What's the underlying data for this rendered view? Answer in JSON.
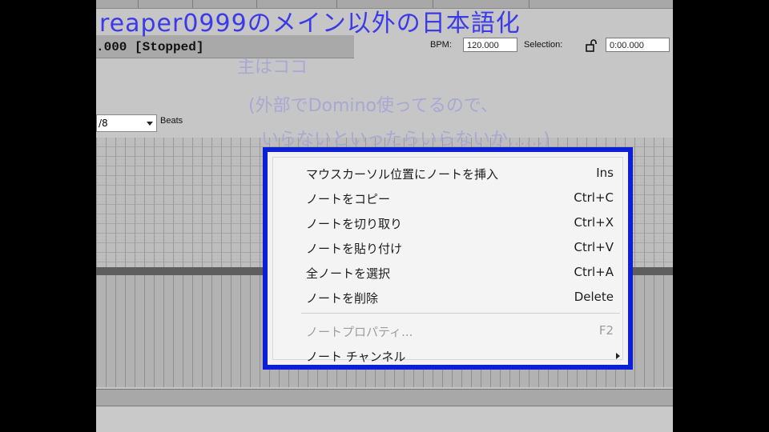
{
  "overlay": {
    "title": "reaper0999のメイン以外の日本語化",
    "note_line1": "主はココ",
    "note_line2": "(外部でDomino使ってるので、",
    "note_line3": "いらないといったらいらないか……)"
  },
  "transport": {
    "time_status": ".000 [Stopped]",
    "bpm_label": "BPM:",
    "bpm_value": "120.000",
    "selection_label": "Selection:",
    "selection_value": "0:00.000"
  },
  "editor": {
    "beats_value": "/8",
    "beats_label": "Beats"
  },
  "context_menu": {
    "items": [
      {
        "label": "マウスカーソル位置にノートを挿入",
        "shortcut": "Ins"
      },
      {
        "label": "ノートをコピー",
        "shortcut": "Ctrl+C"
      },
      {
        "label": "ノートを切り取り",
        "shortcut": "Ctrl+X"
      },
      {
        "label": "ノートを貼り付け",
        "shortcut": "Ctrl+V"
      },
      {
        "label": "全ノートを選択",
        "shortcut": "Ctrl+A"
      },
      {
        "label": "ノートを削除",
        "shortcut": "Delete"
      },
      {
        "label": "ノートプロパティ...",
        "shortcut": "F2"
      },
      {
        "label": "ノート チャンネル",
        "shortcut": ""
      }
    ]
  },
  "colors": {
    "menu_border": "#0a1fd6",
    "overlay_title": "#3a3ae8"
  },
  "icons": {
    "lock": "unlock-icon",
    "dropdown": "chevron-down-icon",
    "submenu": "chevron-right-icon"
  }
}
